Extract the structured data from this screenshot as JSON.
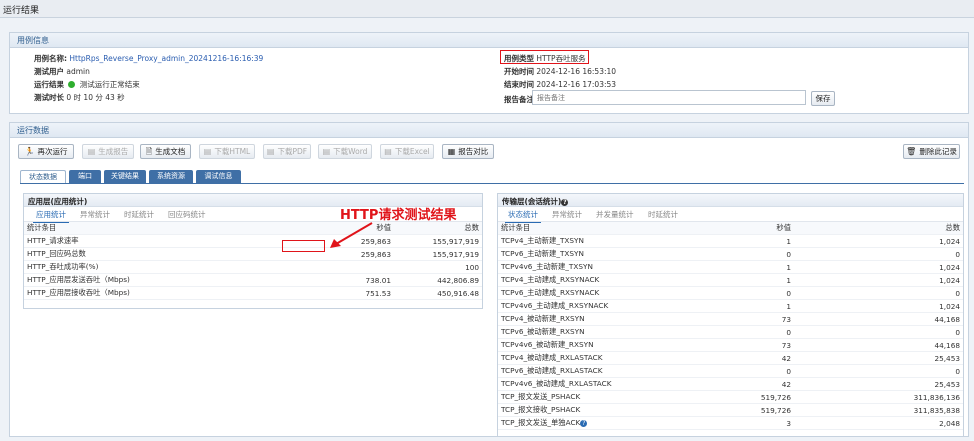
{
  "window": {
    "title": "运行结果"
  },
  "case_info": {
    "header": "用例信息",
    "name_label": "用例名称:",
    "name_value": "HttpRps_Reverse_Proxy_admin_20241216-16:16:39",
    "user_label": "测试用户",
    "user_value": "admin",
    "result_label": "运行结果",
    "result_value": "测试运行正常结束",
    "duration_label": "测试时长",
    "duration_value": "0 时 10 分 43 秒",
    "type_label": "用例类型",
    "type_value": "HTTP吞吐服务",
    "start_label": "开始时间",
    "start_value": "2024-12-16 16:53:10",
    "end_label": "结束时间",
    "end_value": "2024-12-16 17:03:53",
    "note_label": "报告备注",
    "note_placeholder": "报告备注",
    "save_label": "保存"
  },
  "run_data": {
    "header": "运行数据",
    "toolbar": {
      "rerun": "再次运行",
      "gen_report": "生成报告",
      "gen_doc": "生成文档",
      "dl_html": "下载HTML",
      "dl_pdf": "下载PDF",
      "dl_word": "下载Word",
      "dl_excel": "下载Excel",
      "compare": "报告对比",
      "delete": "删除此记录"
    },
    "tabs": [
      "状态数据",
      "端口",
      "关键结果",
      "系统资源",
      "调试信息"
    ]
  },
  "app_layer": {
    "title": "应用层(应用统计)",
    "subtabs": [
      "应用统计",
      "异常统计",
      "时延统计",
      "回应码统计"
    ],
    "columns": [
      "统计条目",
      "秒值",
      "总数"
    ],
    "rows": [
      [
        "HTTP_请求速率",
        "259,863",
        "155,917,919"
      ],
      [
        "HTTP_回应码总数",
        "259,863",
        "155,917,919"
      ],
      [
        "HTTP_吞吐成功率(%)",
        "",
        "100"
      ],
      [
        "HTTP_应用层发送吞吐（Mbps)",
        "738.01",
        "442,806.89"
      ],
      [
        "HTTP_应用层接收吞吐（Mbps)",
        "751.53",
        "450,916.48"
      ]
    ]
  },
  "annotation": "HTTP请求测试结果",
  "transport_layer": {
    "title": "传输层(会话统计)",
    "subtabs": [
      "状态统计",
      "异常统计",
      "并发量统计",
      "时延统计"
    ],
    "columns": [
      "统计条目",
      "秒值",
      "总数"
    ],
    "rows": [
      [
        "TCPv4_主动新建_TXSYN",
        "1",
        "1,024"
      ],
      [
        "TCPv6_主动新建_TXSYN",
        "0",
        "0"
      ],
      [
        "TCPv4v6_主动新建_TXSYN",
        "1",
        "1,024"
      ],
      [
        "TCPv4_主动建成_RXSYNACK",
        "1",
        "1,024"
      ],
      [
        "TCPv6_主动建成_RXSYNACK",
        "0",
        "0"
      ],
      [
        "TCPv4v6_主动建成_RXSYNACK",
        "1",
        "1,024"
      ],
      [
        "TCPv4_被动新建_RXSYN",
        "73",
        "44,168"
      ],
      [
        "TCPv6_被动新建_RXSYN",
        "0",
        "0"
      ],
      [
        "TCPv4v6_被动新建_RXSYN",
        "73",
        "44,168"
      ],
      [
        "TCPv4_被动建成_RXLASTACK",
        "42",
        "25,453"
      ],
      [
        "TCPv6_被动建成_RXLASTACK",
        "0",
        "0"
      ],
      [
        "TCPv4v6_被动建成_RXLASTACK",
        "42",
        "25,453"
      ],
      [
        "TCP_报文发送_PSHACK",
        "519,726",
        "311,836,136"
      ],
      [
        "TCP_报文接收_PSHACK",
        "519,726",
        "311,835,838"
      ],
      [
        "TCP_报文发送_单独ACK",
        "3",
        "2,048"
      ]
    ]
  }
}
